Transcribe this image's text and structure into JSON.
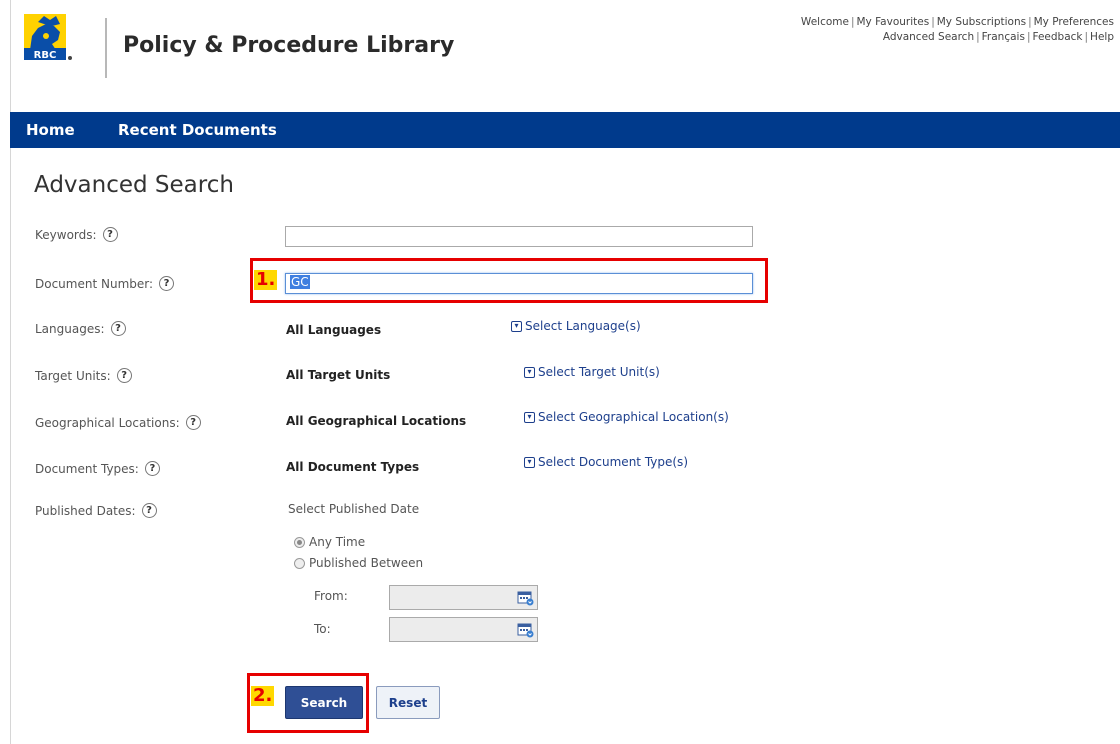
{
  "header": {
    "logo_text": "RBC",
    "app_title": "Policy & Procedure Library",
    "utility_links_row1": [
      "Welcome",
      "My Favourites",
      "My Subscriptions",
      "My Preferences"
    ],
    "utility_links_row2": [
      "Advanced Search",
      "Français",
      "Feedback",
      "Help"
    ],
    "separator": "|"
  },
  "nav": {
    "items": [
      "Home",
      "Recent Documents"
    ],
    "background": "#003a8c"
  },
  "page": {
    "title": "Advanced Search"
  },
  "form": {
    "keywords": {
      "label": "Keywords:",
      "value": ""
    },
    "document_number": {
      "label": "Document Number:",
      "value": "GC"
    },
    "languages": {
      "label": "Languages:",
      "value": "All Languages",
      "link": "Select Language(s)"
    },
    "target_units": {
      "label": "Target Units:",
      "value": "All Target Units",
      "link": "Select Target Unit(s)"
    },
    "geo_locations": {
      "label": "Geographical Locations:",
      "value": "All Geographical Locations",
      "link": "Select Geographical Location(s)"
    },
    "document_types": {
      "label": "Document Types:",
      "value": "All Document Types",
      "link": "Select Document Type(s)"
    },
    "published_dates": {
      "label": "Published Dates:",
      "heading": "Select Published Date",
      "options": [
        "Any Time",
        "Published Between"
      ],
      "selected": "Any Time",
      "from_label": "From:",
      "to_label": "To:"
    },
    "help_glyph": "?",
    "buttons": {
      "search": "Search",
      "reset": "Reset"
    }
  },
  "callouts": [
    "1.",
    "2."
  ],
  "colors": {
    "brand_blue": "#003a8c",
    "link_blue": "#1d3f8c",
    "callout_red": "#e60000",
    "callout_yellow": "#ffd800",
    "search_button": "#2f4f95"
  },
  "icons": [
    "rbc-lion-logo-icon",
    "help-icon",
    "checkbox-dropdown-icon",
    "radio-icon",
    "calendar-icon"
  ]
}
